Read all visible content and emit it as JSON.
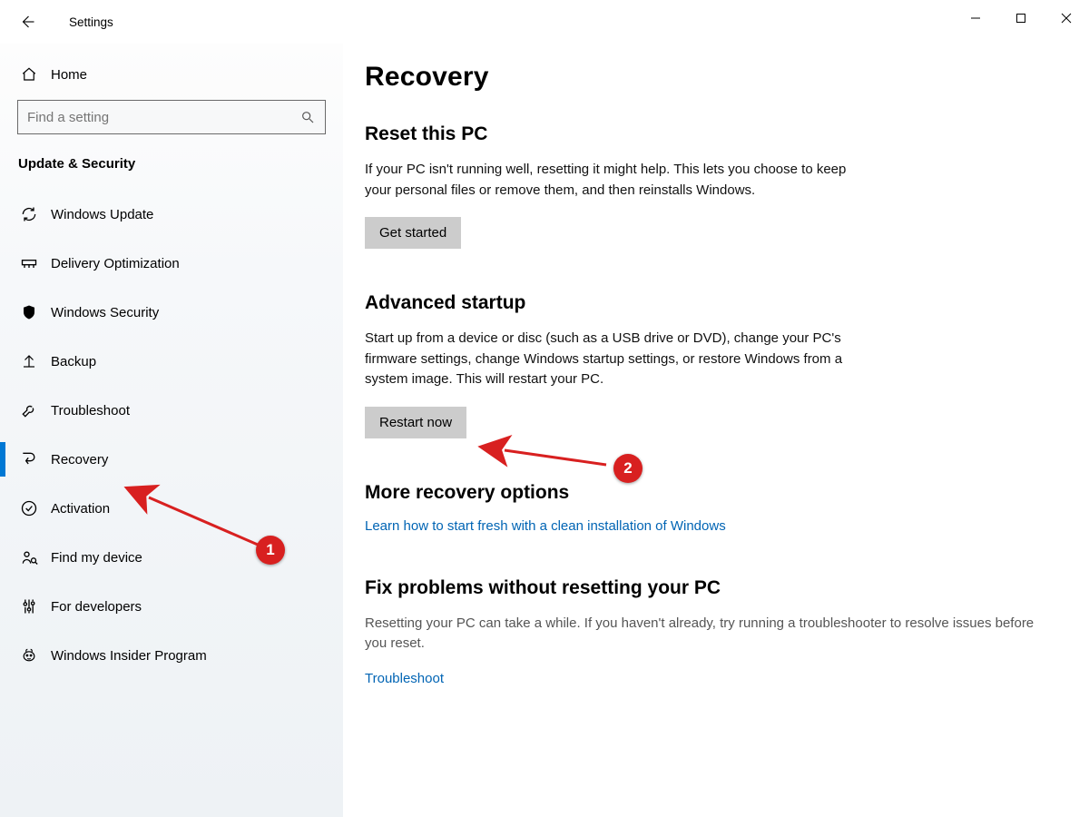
{
  "window": {
    "title": "Settings"
  },
  "sidebar": {
    "home": "Home",
    "search_placeholder": "Find a setting",
    "section": "Update & Security",
    "items": [
      {
        "label": "Windows Update"
      },
      {
        "label": "Delivery Optimization"
      },
      {
        "label": "Windows Security"
      },
      {
        "label": "Backup"
      },
      {
        "label": "Troubleshoot"
      },
      {
        "label": "Recovery",
        "active": true
      },
      {
        "label": "Activation"
      },
      {
        "label": "Find my device"
      },
      {
        "label": "For developers"
      },
      {
        "label": "Windows Insider Program"
      }
    ]
  },
  "content": {
    "page_title": "Recovery",
    "reset": {
      "heading": "Reset this PC",
      "body": "If your PC isn't running well, resetting it might help. This lets you choose to keep your personal files or remove them, and then reinstalls Windows.",
      "button": "Get started"
    },
    "advanced": {
      "heading": "Advanced startup",
      "body": "Start up from a device or disc (such as a USB drive or DVD), change your PC's firmware settings, change Windows startup settings, or restore Windows from a system image. This will restart your PC.",
      "button": "Restart now"
    },
    "more": {
      "heading": "More recovery options",
      "link": "Learn how to start fresh with a clean installation of Windows"
    },
    "fix": {
      "heading": "Fix problems without resetting your PC",
      "body": "Resetting your PC can take a while. If you haven't already, try running a troubleshooter to resolve issues before you reset.",
      "link": "Troubleshoot"
    }
  },
  "annotations": {
    "badge1": "1",
    "badge2": "2"
  }
}
